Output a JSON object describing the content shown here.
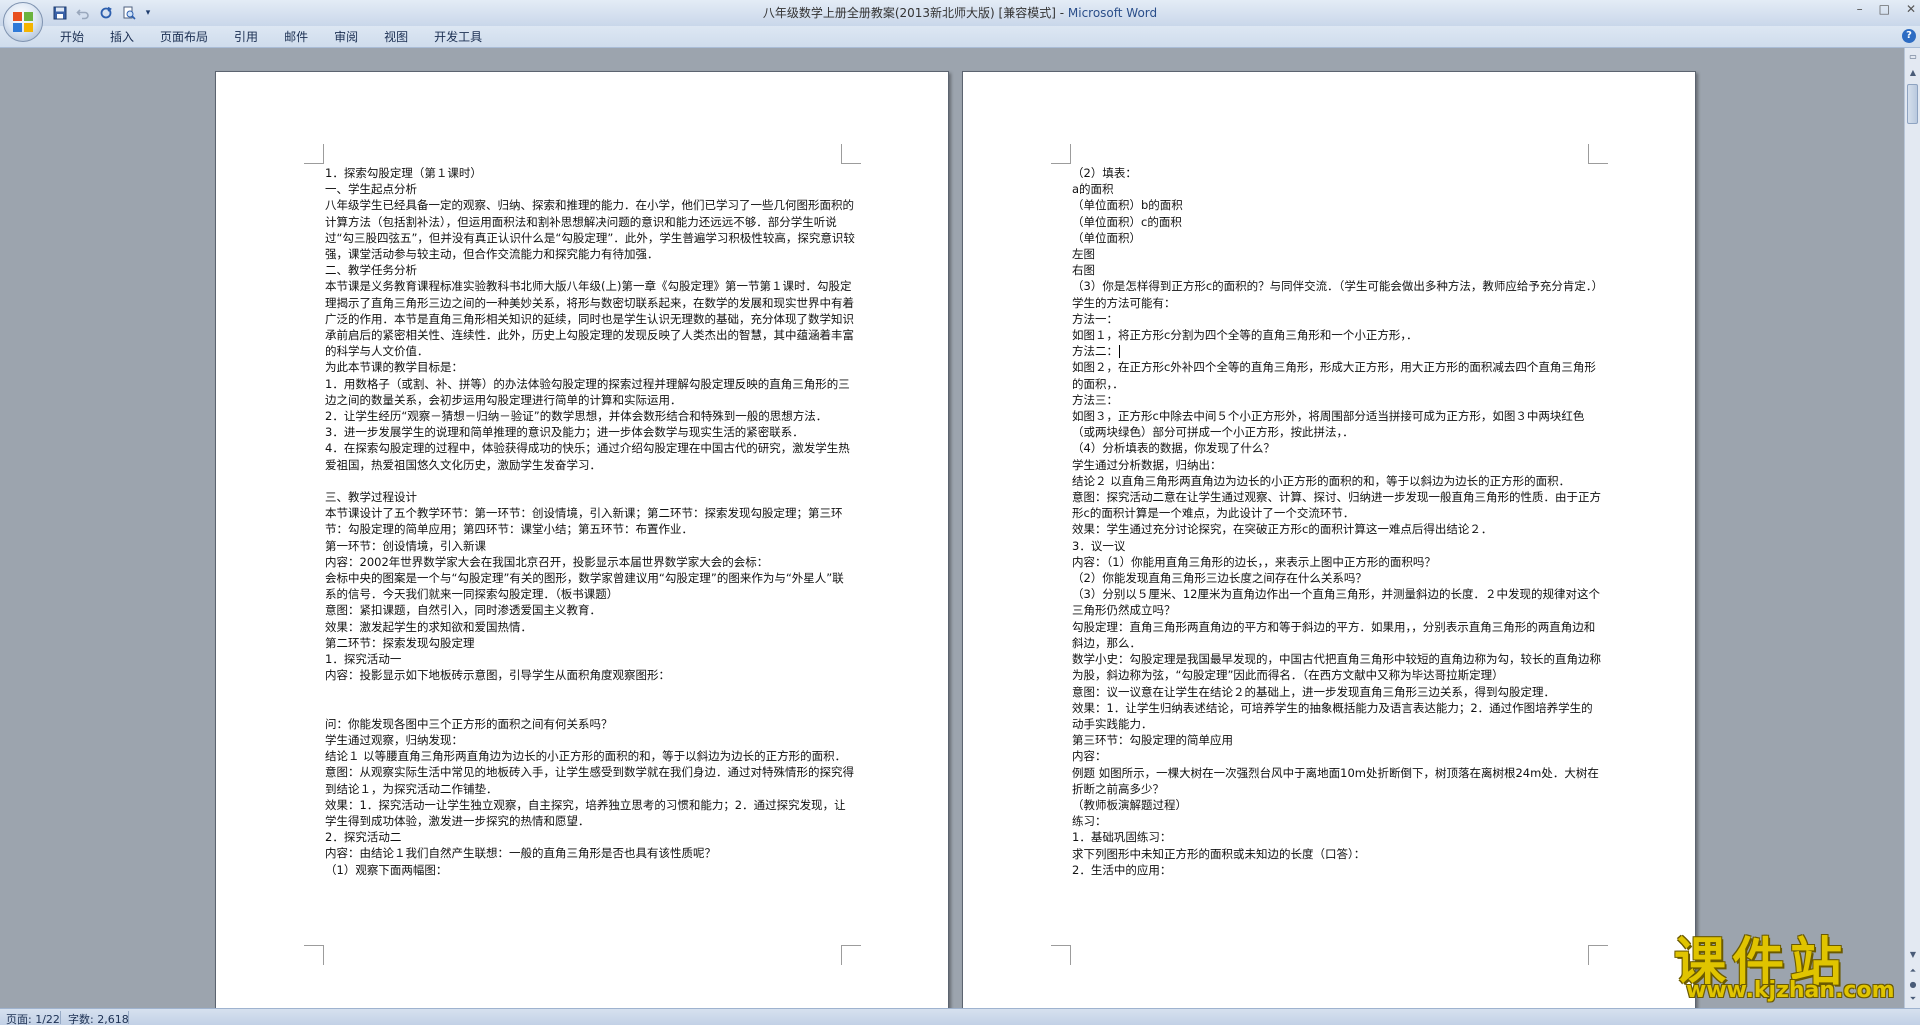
{
  "window": {
    "title_doc": "八年级数学上册全册教案(2013新北师大版) [兼容模式] - ",
    "title_app": "Microsoft Word",
    "controls": [
      "–",
      "□",
      "✕"
    ]
  },
  "qat": {
    "separator": "▾"
  },
  "ribbon": {
    "tabs": [
      "开始",
      "插入",
      "页面布局",
      "引用",
      "邮件",
      "审阅",
      "视图",
      "开发工具"
    ],
    "help": "?"
  },
  "left_page": {
    "lines": [
      "1．探索勾股定理（第１课时）",
      "一、学生起点分析",
      "八年级学生已经具备一定的观察、归纳、探索和推理的能力．在小学，他们已学习了一些几何图形面积的计算方法（包括割补法），但运用面积法和割补思想解决问题的意识和能力还远远不够．部分学生听说过“勾三股四弦五”，但并没有真正认识什么是“勾股定理”．此外，学生普遍学习积极性较高，探究意识较强，课堂活动参与较主动，但合作交流能力和探究能力有待加强．",
      "二、教学任务分析",
      "本节课是义务教育课程标准实验教科书北师大版八年级(上)第一章《勾股定理》第一节第１课时．勾股定理揭示了直角三角形三边之间的一种美妙关系，将形与数密切联系起来，在数学的发展和现实世界中有着广泛的作用．本节是直角三角形相关知识的延续，同时也是学生认识无理数的基础，充分体现了数学知识承前启后的紧密相关性、连续性．此外，历史上勾股定理的发现反映了人类杰出的智慧，其中蕴涵着丰富的科学与人文价值．",
      "为此本节课的教学目标是：",
      "1．用数格子（或割、补、拼等）的办法体验勾股定理的探索过程并理解勾股定理反映的直角三角形的三边之间的数量关系，会初步运用勾股定理进行简单的计算和实际运用．",
      "2．让学生经历“观察－猜想－归纳－验证”的数学思想，并体会数形结合和特殊到一般的思想方法．",
      "3．进一步发展学生的说理和简单推理的意识及能力；进一步体会数学与现实生活的紧密联系．",
      "4．在探索勾股定理的过程中，体验获得成功的快乐；通过介绍勾股定理在中国古代的研究，激发学生热爱祖国，热爱祖国悠久文化历史，激励学生发奋学习．",
      "",
      "三、教学过程设计",
      "本节课设计了五个教学环节：第一环节：创设情境，引入新课；第二环节：探索发现勾股定理；第三环节：勾股定理的简单应用；第四环节：课堂小结；第五环节：布置作业．",
      "第一环节：创设情境，引入新课",
      "内容：2002年世界数学家大会在我国北京召开，投影显示本届世界数学家大会的会标：",
      "会标中央的图案是一个与“勾股定理”有关的图形，数学家曾建议用“勾股定理”的图来作为与“外星人”联系的信号．今天我们就来一同探索勾股定理．（板书课题）",
      "意图：紧扣课题，自然引入，同时渗透爱国主义教育．",
      "效果：激发起学生的求知欲和爱国热情．",
      "第二环节：探索发现勾股定理",
      "1．探究活动一",
      "内容：投影显示如下地板砖示意图，引导学生从面积角度观察图形：",
      "",
      "",
      "问：你能发现各图中三个正方形的面积之间有何关系吗？",
      "学生通过观察，归纳发现：",
      "结论１ 以等腰直角三角形两直角边为边长的小正方形的面积的和，等于以斜边为边长的正方形的面积．",
      "意图：从观察实际生活中常见的地板砖入手，让学生感受到数学就在我们身边．通过对特殊情形的探究得到结论１，为探究活动二作铺垫．",
      "效果：1．探究活动一让学生独立观察，自主探究，培养独立思考的习惯和能力；2．通过探究发现，让学生得到成功体验，激发进一步探究的热情和愿望．",
      "2．探究活动二",
      "内容：由结论１我们自然产生联想：一般的直角三角形是否也具有该性质呢？",
      "（1）观察下面两幅图："
    ]
  },
  "right_page": {
    "lines": [
      "（2）填表：",
      "a的面积",
      "（单位面积）b的面积",
      "（单位面积）c的面积",
      "（单位面积）",
      "左图",
      "右图",
      "（3）你是怎样得到正方形c的面积的？与同伴交流．（学生可能会做出多种方法，教师应给予充分肯定．）",
      "学生的方法可能有：",
      "方法一：",
      "如图１，将正方形c分割为四个全等的直角三角形和一个小正方形，．",
      "方法二：",
      "如图２，在正方形c外补四个全等的直角三角形，形成大正方形，用大正方形的面积减去四个直角三角形的面积，．",
      "方法三：",
      "如图３，正方形c中除去中间５个小正方形外，将周围部分适当拼接可成为正方形，如图３中两块红色（或两块绿色）部分可拼成一个小正方形，按此拼法，．",
      "（4）分析填表的数据，你发现了什么？",
      "学生通过分析数据，归纳出：",
      "结论２ 以直角三角形两直角边为边长的小正方形的面积的和，等于以斜边为边长的正方形的面积．",
      "意图：探究活动二意在让学生通过观察、计算、探讨、归纳进一步发现一般直角三角形的性质．由于正方形c的面积计算是一个难点，为此设计了一个交流环节．",
      "效果：学生通过充分讨论探究，在突破正方形c的面积计算这一难点后得出结论２．",
      "3．议一议",
      "内容：（1）你能用直角三角形的边长，，来表示上图中正方形的面积吗？",
      "（2）你能发现直角三角形三边长度之间存在什么关系吗？",
      "（3）分别以５厘米、12厘米为直角边作出一个直角三角形，并测量斜边的长度．２中发现的规律对这个三角形仍然成立吗？",
      "勾股定理：直角三角形两直角边的平方和等于斜边的平方．如果用，，分别表示直角三角形的两直角边和斜边，那么．",
      "数学小史：勾股定理是我国最早发现的，中国古代把直角三角形中较短的直角边称为勾，较长的直角边称为股，斜边称为弦，“勾股定理”因此而得名．（在西方文献中又称为毕达哥拉斯定理）",
      "意图：议一议意在让学生在结论２的基础上，进一步发现直角三角形三边关系，得到勾股定理．",
      "效果：1．让学生归纳表述结论，可培养学生的抽象概括能力及语言表达能力；2．通过作图培养学生的动手实践能力．",
      "第三环节：勾股定理的简单应用",
      "内容：",
      "例题 如图所示，一棵大树在一次强烈台风中于离地面10m处折断倒下，树顶落在离树根24m处．大树在折断之前高多少？",
      "（教师板演解题过程）",
      "练习：",
      "1．基础巩固练习：",
      "求下列图形中未知正方形的面积或未知边的长度（口答）：",
      "2．生活中的应用："
    ]
  },
  "status": {
    "page": "页面: 1/22",
    "words": "字数: 2,618"
  },
  "watermark": {
    "cn": "课件站",
    "url": "www.kjzhan.com"
  },
  "icons": [
    "office-button-icon",
    "save-icon",
    "undo-icon",
    "redo-icon",
    "print-preview-icon"
  ]
}
